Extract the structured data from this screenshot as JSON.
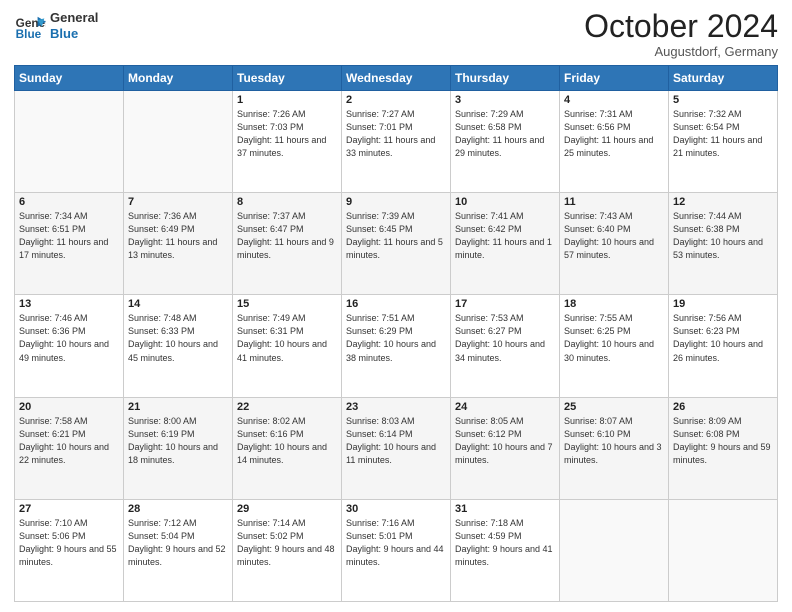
{
  "header": {
    "logo_line1": "General",
    "logo_line2": "Blue",
    "month": "October 2024",
    "location": "Augustdorf, Germany"
  },
  "days_of_week": [
    "Sunday",
    "Monday",
    "Tuesday",
    "Wednesday",
    "Thursday",
    "Friday",
    "Saturday"
  ],
  "weeks": [
    [
      {
        "day": "",
        "info": ""
      },
      {
        "day": "",
        "info": ""
      },
      {
        "day": "1",
        "info": "Sunrise: 7:26 AM\nSunset: 7:03 PM\nDaylight: 11 hours and 37 minutes."
      },
      {
        "day": "2",
        "info": "Sunrise: 7:27 AM\nSunset: 7:01 PM\nDaylight: 11 hours and 33 minutes."
      },
      {
        "day": "3",
        "info": "Sunrise: 7:29 AM\nSunset: 6:58 PM\nDaylight: 11 hours and 29 minutes."
      },
      {
        "day": "4",
        "info": "Sunrise: 7:31 AM\nSunset: 6:56 PM\nDaylight: 11 hours and 25 minutes."
      },
      {
        "day": "5",
        "info": "Sunrise: 7:32 AM\nSunset: 6:54 PM\nDaylight: 11 hours and 21 minutes."
      }
    ],
    [
      {
        "day": "6",
        "info": "Sunrise: 7:34 AM\nSunset: 6:51 PM\nDaylight: 11 hours and 17 minutes."
      },
      {
        "day": "7",
        "info": "Sunrise: 7:36 AM\nSunset: 6:49 PM\nDaylight: 11 hours and 13 minutes."
      },
      {
        "day": "8",
        "info": "Sunrise: 7:37 AM\nSunset: 6:47 PM\nDaylight: 11 hours and 9 minutes."
      },
      {
        "day": "9",
        "info": "Sunrise: 7:39 AM\nSunset: 6:45 PM\nDaylight: 11 hours and 5 minutes."
      },
      {
        "day": "10",
        "info": "Sunrise: 7:41 AM\nSunset: 6:42 PM\nDaylight: 11 hours and 1 minute."
      },
      {
        "day": "11",
        "info": "Sunrise: 7:43 AM\nSunset: 6:40 PM\nDaylight: 10 hours and 57 minutes."
      },
      {
        "day": "12",
        "info": "Sunrise: 7:44 AM\nSunset: 6:38 PM\nDaylight: 10 hours and 53 minutes."
      }
    ],
    [
      {
        "day": "13",
        "info": "Sunrise: 7:46 AM\nSunset: 6:36 PM\nDaylight: 10 hours and 49 minutes."
      },
      {
        "day": "14",
        "info": "Sunrise: 7:48 AM\nSunset: 6:33 PM\nDaylight: 10 hours and 45 minutes."
      },
      {
        "day": "15",
        "info": "Sunrise: 7:49 AM\nSunset: 6:31 PM\nDaylight: 10 hours and 41 minutes."
      },
      {
        "day": "16",
        "info": "Sunrise: 7:51 AM\nSunset: 6:29 PM\nDaylight: 10 hours and 38 minutes."
      },
      {
        "day": "17",
        "info": "Sunrise: 7:53 AM\nSunset: 6:27 PM\nDaylight: 10 hours and 34 minutes."
      },
      {
        "day": "18",
        "info": "Sunrise: 7:55 AM\nSunset: 6:25 PM\nDaylight: 10 hours and 30 minutes."
      },
      {
        "day": "19",
        "info": "Sunrise: 7:56 AM\nSunset: 6:23 PM\nDaylight: 10 hours and 26 minutes."
      }
    ],
    [
      {
        "day": "20",
        "info": "Sunrise: 7:58 AM\nSunset: 6:21 PM\nDaylight: 10 hours and 22 minutes."
      },
      {
        "day": "21",
        "info": "Sunrise: 8:00 AM\nSunset: 6:19 PM\nDaylight: 10 hours and 18 minutes."
      },
      {
        "day": "22",
        "info": "Sunrise: 8:02 AM\nSunset: 6:16 PM\nDaylight: 10 hours and 14 minutes."
      },
      {
        "day": "23",
        "info": "Sunrise: 8:03 AM\nSunset: 6:14 PM\nDaylight: 10 hours and 11 minutes."
      },
      {
        "day": "24",
        "info": "Sunrise: 8:05 AM\nSunset: 6:12 PM\nDaylight: 10 hours and 7 minutes."
      },
      {
        "day": "25",
        "info": "Sunrise: 8:07 AM\nSunset: 6:10 PM\nDaylight: 10 hours and 3 minutes."
      },
      {
        "day": "26",
        "info": "Sunrise: 8:09 AM\nSunset: 6:08 PM\nDaylight: 9 hours and 59 minutes."
      }
    ],
    [
      {
        "day": "27",
        "info": "Sunrise: 7:10 AM\nSunset: 5:06 PM\nDaylight: 9 hours and 55 minutes."
      },
      {
        "day": "28",
        "info": "Sunrise: 7:12 AM\nSunset: 5:04 PM\nDaylight: 9 hours and 52 minutes."
      },
      {
        "day": "29",
        "info": "Sunrise: 7:14 AM\nSunset: 5:02 PM\nDaylight: 9 hours and 48 minutes."
      },
      {
        "day": "30",
        "info": "Sunrise: 7:16 AM\nSunset: 5:01 PM\nDaylight: 9 hours and 44 minutes."
      },
      {
        "day": "31",
        "info": "Sunrise: 7:18 AM\nSunset: 4:59 PM\nDaylight: 9 hours and 41 minutes."
      },
      {
        "day": "",
        "info": ""
      },
      {
        "day": "",
        "info": ""
      }
    ]
  ]
}
